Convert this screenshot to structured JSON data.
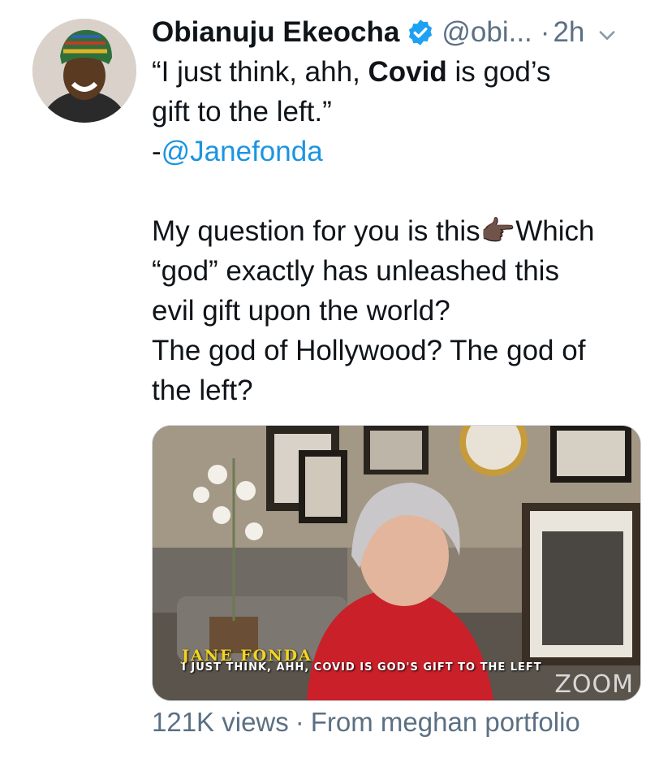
{
  "tweet": {
    "author_name": "Obianuju Ekeocha",
    "handle": "@obi...",
    "dot": "·",
    "time": "2h",
    "lines": {
      "l1_a": "“I just think, ahh, ",
      "l1_b": "Covid",
      "l1_c": " is god’s",
      "l2": "gift to the left.”",
      "l3_a": "-",
      "l3_b": "@Janefonda",
      "l4": "",
      "l5_a": "My question for you is this",
      "l5_emoji": "👉🏿",
      "l5_b": "Which",
      "l6": "“god” exactly has unleashed this",
      "l7": "evil gift upon the world?",
      "l8": "The god of Hollywood? The god of",
      "l9": "the left?"
    }
  },
  "media": {
    "caption_name": "JANE FONDA",
    "caption_quote": "I JUST THINK, AHH, COVID IS GOD'S GIFT TO THE LEFT",
    "watermark": "ZOOM"
  },
  "footer": {
    "views": "121K views",
    "sep": "·",
    "source": "From meghan portfolio"
  },
  "colors": {
    "link": "#1b95e0",
    "verified": "#1da1f2",
    "secondary": "#5b7083"
  },
  "icons": {
    "verified": "verified-badge-icon",
    "more": "chevron-down-icon"
  }
}
